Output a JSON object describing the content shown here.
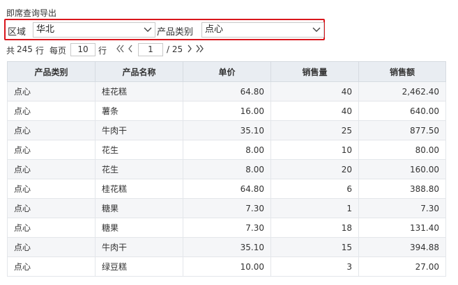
{
  "title": "即席查询导出",
  "filters": {
    "region_label": "区域",
    "region_value": "华北",
    "category_label": "产品类别",
    "category_value": "点心"
  },
  "pager": {
    "total_prefix": "共",
    "total_count": "245",
    "total_suffix": "行",
    "per_page_label": "每页",
    "per_page_value": "10",
    "per_page_unit": "行",
    "current_page": "1",
    "page_total": "/ 25"
  },
  "table": {
    "headers": [
      "产品类别",
      "产品名称",
      "单价",
      "销售量",
      "销售额"
    ],
    "rows": [
      [
        "点心",
        "桂花糕",
        "64.80",
        "40",
        "2,462.40"
      ],
      [
        "点心",
        "薯条",
        "16.00",
        "40",
        "640.00"
      ],
      [
        "点心",
        "牛肉干",
        "35.10",
        "25",
        "877.50"
      ],
      [
        "点心",
        "花生",
        "8.00",
        "10",
        "80.00"
      ],
      [
        "点心",
        "花生",
        "8.00",
        "20",
        "160.00"
      ],
      [
        "点心",
        "桂花糕",
        "64.80",
        "6",
        "388.80"
      ],
      [
        "点心",
        "糖果",
        "7.30",
        "1",
        "7.30"
      ],
      [
        "点心",
        "糖果",
        "7.30",
        "18",
        "131.40"
      ],
      [
        "点心",
        "牛肉干",
        "35.10",
        "15",
        "394.88"
      ],
      [
        "点心",
        "绿豆糕",
        "10.00",
        "3",
        "27.00"
      ]
    ]
  },
  "colors": {
    "highlight_border": "#d9161c",
    "header_bg": "#e9edf2",
    "row_alt_bg": "#f5f6f8"
  },
  "icons": [
    "chevron-down-icon",
    "first-page-icon",
    "prev-page-icon",
    "next-page-icon",
    "last-page-icon"
  ]
}
